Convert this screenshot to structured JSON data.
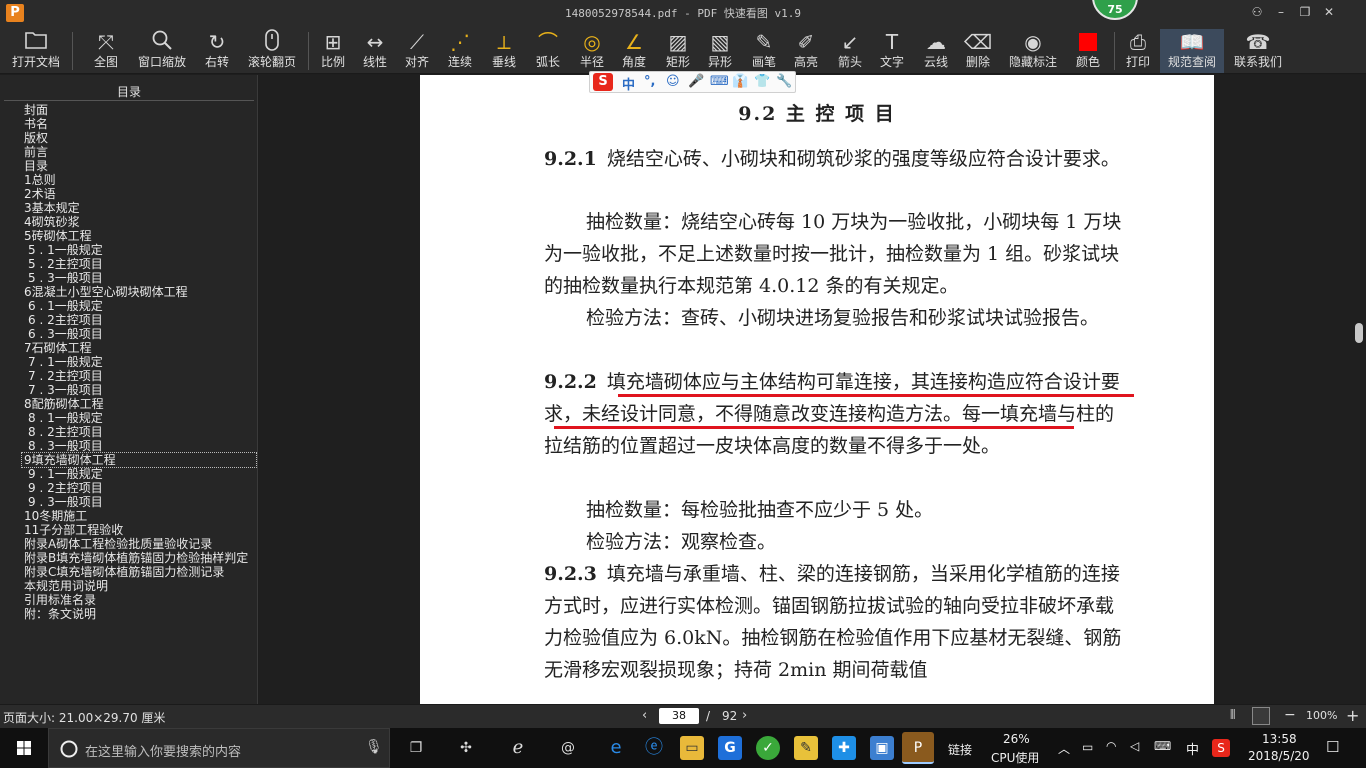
{
  "window": {
    "title": "1480052978544.pdf - PDF 快速看图 v1.9",
    "logo_letter": "P",
    "perf_badge": "75",
    "controls": [
      "⚇",
      "–",
      "❐",
      "✕"
    ]
  },
  "toolbar": {
    "items": [
      {
        "label": "打开文档",
        "icon": "folder-icon"
      },
      {
        "label": "全图",
        "icon": "fit-page-icon"
      },
      {
        "label": "窗口缩放",
        "icon": "zoom-window-icon"
      },
      {
        "label": "右转",
        "icon": "rotate-right-icon"
      },
      {
        "label": "滚轮翻页",
        "icon": "mouse-scroll-icon"
      },
      {
        "label": "比例",
        "icon": "scale-icon"
      },
      {
        "label": "线性",
        "icon": "linear-measure-icon"
      },
      {
        "label": "对齐",
        "icon": "align-icon"
      },
      {
        "label": "连续",
        "icon": "continuous-measure-icon"
      },
      {
        "label": "垂线",
        "icon": "perpendicular-icon"
      },
      {
        "label": "弧长",
        "icon": "arc-length-icon"
      },
      {
        "label": "半径",
        "icon": "radius-icon"
      },
      {
        "label": "角度",
        "icon": "angle-icon"
      },
      {
        "label": "矩形",
        "icon": "rectangle-icon"
      },
      {
        "label": "异形",
        "icon": "irregular-shape-icon"
      },
      {
        "label": "画笔",
        "icon": "pen-icon"
      },
      {
        "label": "高亮",
        "icon": "highlighter-icon"
      },
      {
        "label": "箭头",
        "icon": "arrow-icon"
      },
      {
        "label": "文字",
        "icon": "text-icon"
      },
      {
        "label": "云线",
        "icon": "cloud-line-icon"
      },
      {
        "label": "删除",
        "icon": "eraser-icon"
      },
      {
        "label": "隐藏标注",
        "icon": "hide-annotation-icon"
      },
      {
        "label": "颜色",
        "icon": "color-swatch-icon"
      },
      {
        "label": "打印",
        "icon": "printer-icon"
      },
      {
        "label": "规范查阅",
        "icon": "book-icon"
      },
      {
        "label": "联系我们",
        "icon": "contact-icon"
      }
    ],
    "color_value": "#ff0000"
  },
  "sidebar": {
    "title": "目录",
    "items": [
      "封面",
      "书名",
      "版权",
      "前言",
      "目录",
      "1总则",
      "2术语",
      "3基本规定",
      "4砌筑砂浆",
      "5砖砌体工程",
      "5 . 1一般规定",
      "5 . 2主控项目",
      "5 . 3一般项目",
      "6混凝土小型空心砌块砌体工程",
      "6 . 1一般规定",
      "6 . 2主控项目",
      "6 . 3一般项目",
      "7石砌体工程",
      "7 . 1一般规定",
      "7 . 2主控项目",
      "7 . 3一般项目",
      "8配筋砌体工程",
      "8 . 1一般规定",
      "8 . 2主控项目",
      "8 . 3一般项目",
      "9填充墙砌体工程",
      "9 . 1一般规定",
      "9 . 2主控项目",
      "9 . 3一般项目",
      "10冬期施工",
      "11子分部工程验收",
      "附录A砌体工程检验批质量验收记录",
      "附录B填充墙砌体植筋锚固力检验抽样判定",
      "附录C填充墙砌体植筋锚固力检测记录",
      "本规范用词说明",
      "引用标准名录",
      "附：条文说明"
    ],
    "selected_index": 25,
    "indent_levels": [
      0,
      0,
      0,
      0,
      0,
      0,
      0,
      0,
      0,
      0,
      1,
      1,
      1,
      0,
      1,
      1,
      1,
      0,
      1,
      1,
      1,
      0,
      1,
      1,
      1,
      0,
      1,
      1,
      1,
      0,
      0,
      0,
      0,
      0,
      0,
      0,
      0
    ]
  },
  "ime": {
    "logo": "S",
    "items": [
      "中",
      "°,",
      "☺",
      "🎤",
      "⌨",
      "👔",
      "👕",
      "🔧"
    ]
  },
  "document": {
    "heading": "9.2  主 控 项 目",
    "paragraphs": [
      {
        "num": "9.2.1",
        "text": "烧结空心砖、小砌块和砌筑砂浆的强度等级应符合设计要求。"
      },
      {
        "num": "",
        "text": "抽检数量：烧结空心砖每 10 万块为一验收批，小砌块每 1 万块为一验收批，不足上述数量时按一批计，抽检数量为 1 组。砂浆试块的抽检数量执行本规范第 4.0.12 条的有关规定。"
      },
      {
        "num": "",
        "text": "检验方法：查砖、小砌块进场复验报告和砂浆试块试验报告。"
      },
      {
        "num": "9.2.2",
        "text": "填充墙砌体应与主体结构可靠连接，其连接构造应符合设计要求，未经设计同意，不得随意改变连接构造方法。每一填充墙与柱的拉结筋的位置超过一皮块体高度的数量不得多于一处。"
      },
      {
        "num": "",
        "text": "抽检数量：每检验批抽查不应少于 5 处。"
      },
      {
        "num": "",
        "text": "检验方法：观察检查。"
      },
      {
        "num": "9.2.3",
        "text": "填充墙与承重墙、柱、梁的连接钢筋，当采用化学植筋的连接方式时，应进行实体检测。锚固钢筋拉拔试验的轴向受拉非破坏承载力检验值应为 6.0kN。抽检钢筋在检验值作用下应基材无裂缝、钢筋无滑移宏观裂损现象；持荷 2min 期间荷载值"
      }
    ],
    "annotation_color": "#e0141e"
  },
  "statusbar": {
    "page_size": "页面大小: 21.00×29.70 厘米",
    "current_page": "38",
    "separator": "/",
    "total_pages": "92",
    "zoom": "100%"
  },
  "taskbar": {
    "search_placeholder": "在这里输入你要搜索的内容",
    "tray_link": "链接",
    "cpu_percent": "26%",
    "cpu_label": "CPU使用",
    "ime_char": "中",
    "time": "13:58",
    "date": "2018/5/20"
  }
}
